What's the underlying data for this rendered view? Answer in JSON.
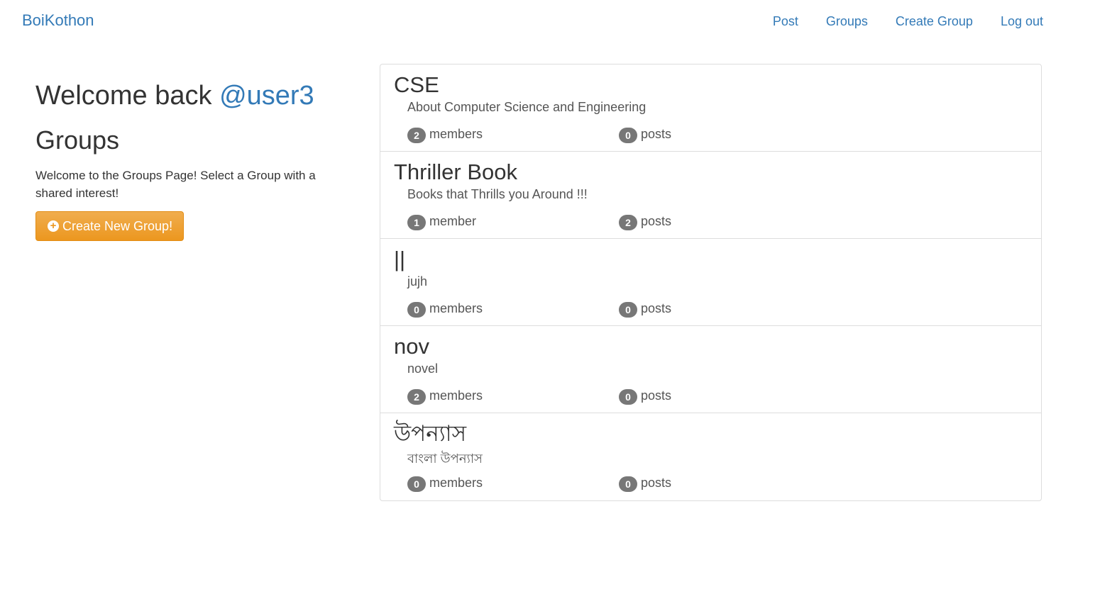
{
  "nav": {
    "brand": "BoiKothon",
    "links": [
      "Post",
      "Groups",
      "Create Group",
      "Log out"
    ]
  },
  "sidebar": {
    "welcome_prefix": "Welcome back ",
    "username": "@user3",
    "title": "Groups",
    "description": "Welcome to the Groups Page! Select a Group with a shared interest!",
    "create_button": "Create New Group!",
    "create_icon": "plus-circle-icon"
  },
  "groups": [
    {
      "name": "CSE",
      "description": "About Computer Science and Engineering",
      "members_count": "2",
      "members_label": "members",
      "posts_count": "0",
      "posts_label": "posts"
    },
    {
      "name": "Thriller Book",
      "description": "Books that Thrills you Around !!!",
      "members_count": "1",
      "members_label": "member",
      "posts_count": "2",
      "posts_label": "posts"
    },
    {
      "name": "||",
      "description": "jujh",
      "members_count": "0",
      "members_label": "members",
      "posts_count": "0",
      "posts_label": "posts"
    },
    {
      "name": "nov",
      "description": "novel",
      "members_count": "2",
      "members_label": "members",
      "posts_count": "0",
      "posts_label": "posts"
    },
    {
      "name": "উপন্যাস",
      "description": "বাংলা উপন্যাস",
      "members_count": "0",
      "members_label": "members",
      "posts_count": "0",
      "posts_label": "posts"
    }
  ],
  "colors": {
    "link": "#337ab7",
    "warning_button": "#f0ad4e",
    "badge": "#777777"
  }
}
